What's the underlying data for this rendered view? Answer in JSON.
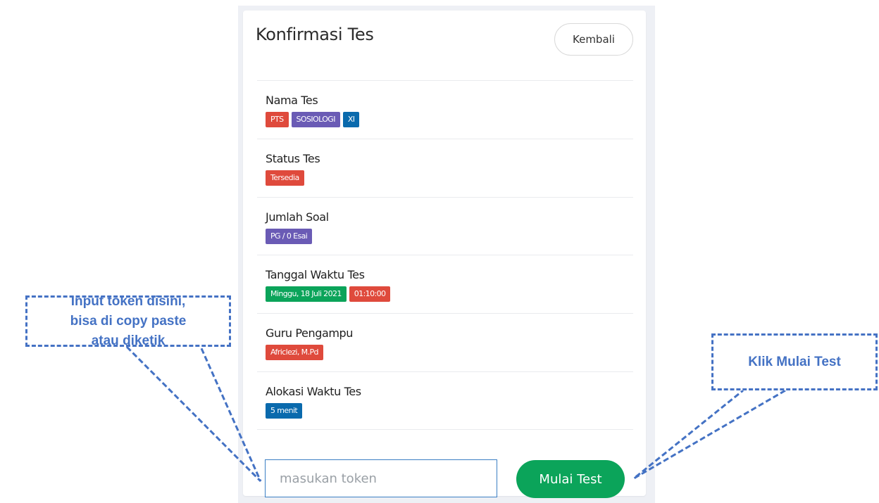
{
  "card": {
    "title": "Konfirmasi Tes",
    "back_label": "Kembali"
  },
  "rows": [
    {
      "label": "Nama Tes",
      "badges": [
        {
          "text": "PTS",
          "color": "#df4a3c"
        },
        {
          "text": "SOSIOLOGI",
          "color": "#6a5bb5"
        },
        {
          "text": "XI",
          "color": "#0a6aad"
        }
      ]
    },
    {
      "label": "Status Tes",
      "badges": [
        {
          "text": "Tersedia",
          "color": "#df4a3c"
        }
      ]
    },
    {
      "label": "Jumlah Soal",
      "badges": [
        {
          "text": "PG / 0 Esai",
          "color": "#6a5bb5"
        }
      ]
    },
    {
      "label": "Tanggal Waktu Tes",
      "badges": [
        {
          "text": "Minggu, 18 Juli 2021",
          "color": "#0ba45a"
        },
        {
          "text": "01:10:00",
          "color": "#df4a3c"
        }
      ]
    },
    {
      "label": "Guru Pengampu",
      "badges": [
        {
          "text": "Africlezi, M.Pd",
          "color": "#df4a3c"
        }
      ]
    },
    {
      "label": "Alokasi Waktu Tes",
      "badges": [
        {
          "text": "5 menit",
          "color": "#0a6aad"
        }
      ]
    }
  ],
  "token": {
    "value": "",
    "placeholder": "masukan token"
  },
  "start_label": "Mulai Test",
  "callouts": {
    "left_lines": [
      "Input token disini,",
      "bisa di copy paste",
      "atau diketik"
    ],
    "right": "Klik Mulai Test"
  },
  "colors": {
    "accent_green": "#0ba45a",
    "badge_red": "#df4a3c",
    "badge_purple": "#6a5bb5",
    "badge_blue": "#0a6aad",
    "callout_blue": "#4472c4"
  }
}
